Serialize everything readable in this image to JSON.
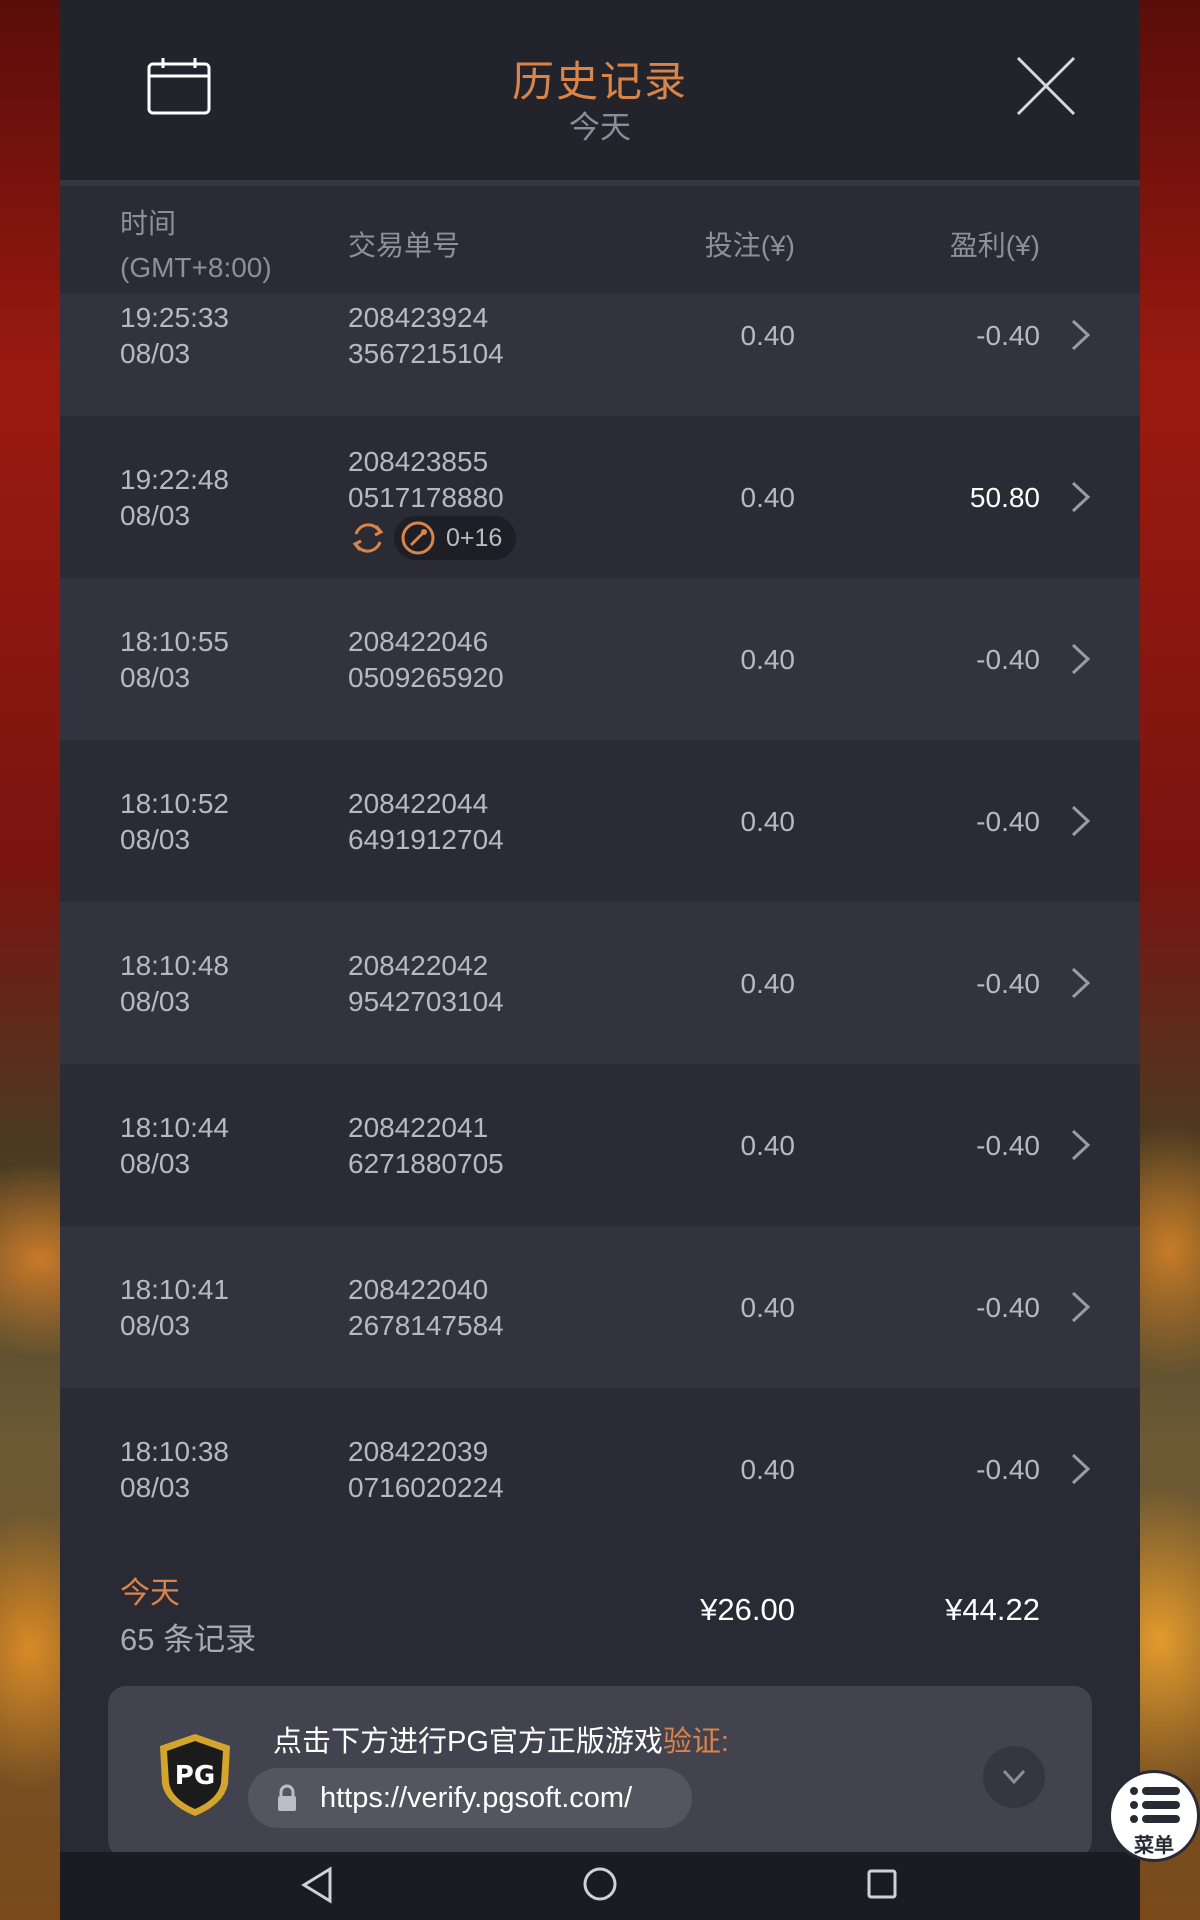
{
  "header": {
    "title": "历史记录",
    "subtitle": "今天"
  },
  "columns": {
    "time_line1": "时间",
    "time_line2": "(GMT+8:00)",
    "order": "交易单号",
    "bet": "投注(¥)",
    "profit": "盈利(¥)"
  },
  "rows": [
    {
      "time": "19:25:33",
      "date": "08/03",
      "order1": "208423924",
      "order2": "3567215104",
      "bet": "0.40",
      "profit": "-0.40"
    },
    {
      "time": "19:22:48",
      "date": "08/03",
      "order1": "208423855",
      "order2": "0517178880",
      "bet": "0.40",
      "profit": "50.80",
      "free_spins": "0+16"
    },
    {
      "time": "18:10:55",
      "date": "08/03",
      "order1": "208422046",
      "order2": "0509265920",
      "bet": "0.40",
      "profit": "-0.40"
    },
    {
      "time": "18:10:52",
      "date": "08/03",
      "order1": "208422044",
      "order2": "6491912704",
      "bet": "0.40",
      "profit": "-0.40"
    },
    {
      "time": "18:10:48",
      "date": "08/03",
      "order1": "208422042",
      "order2": "9542703104",
      "bet": "0.40",
      "profit": "-0.40"
    },
    {
      "time": "18:10:44",
      "date": "08/03",
      "order1": "208422041",
      "order2": "6271880705",
      "bet": "0.40",
      "profit": "-0.40"
    },
    {
      "time": "18:10:41",
      "date": "08/03",
      "order1": "208422040",
      "order2": "2678147584",
      "bet": "0.40",
      "profit": "-0.40"
    },
    {
      "time": "18:10:38",
      "date": "08/03",
      "order1": "208422039",
      "order2": "0716020224",
      "bet": "0.40",
      "profit": "-0.40"
    }
  ],
  "summary": {
    "label": "今天",
    "count": "65 条记录",
    "total_bet": "¥26.00",
    "total_profit": "¥44.22"
  },
  "verify": {
    "text": "点击下方进行PG官方正版游戏",
    "highlight": "验证:",
    "logo_text": "PG",
    "url": "https://verify.pgsoft.com/"
  },
  "menu": {
    "label": "菜单"
  },
  "colors": {
    "accent": "#d9854a",
    "panel": "#2a2a35",
    "header": "#23232c"
  }
}
